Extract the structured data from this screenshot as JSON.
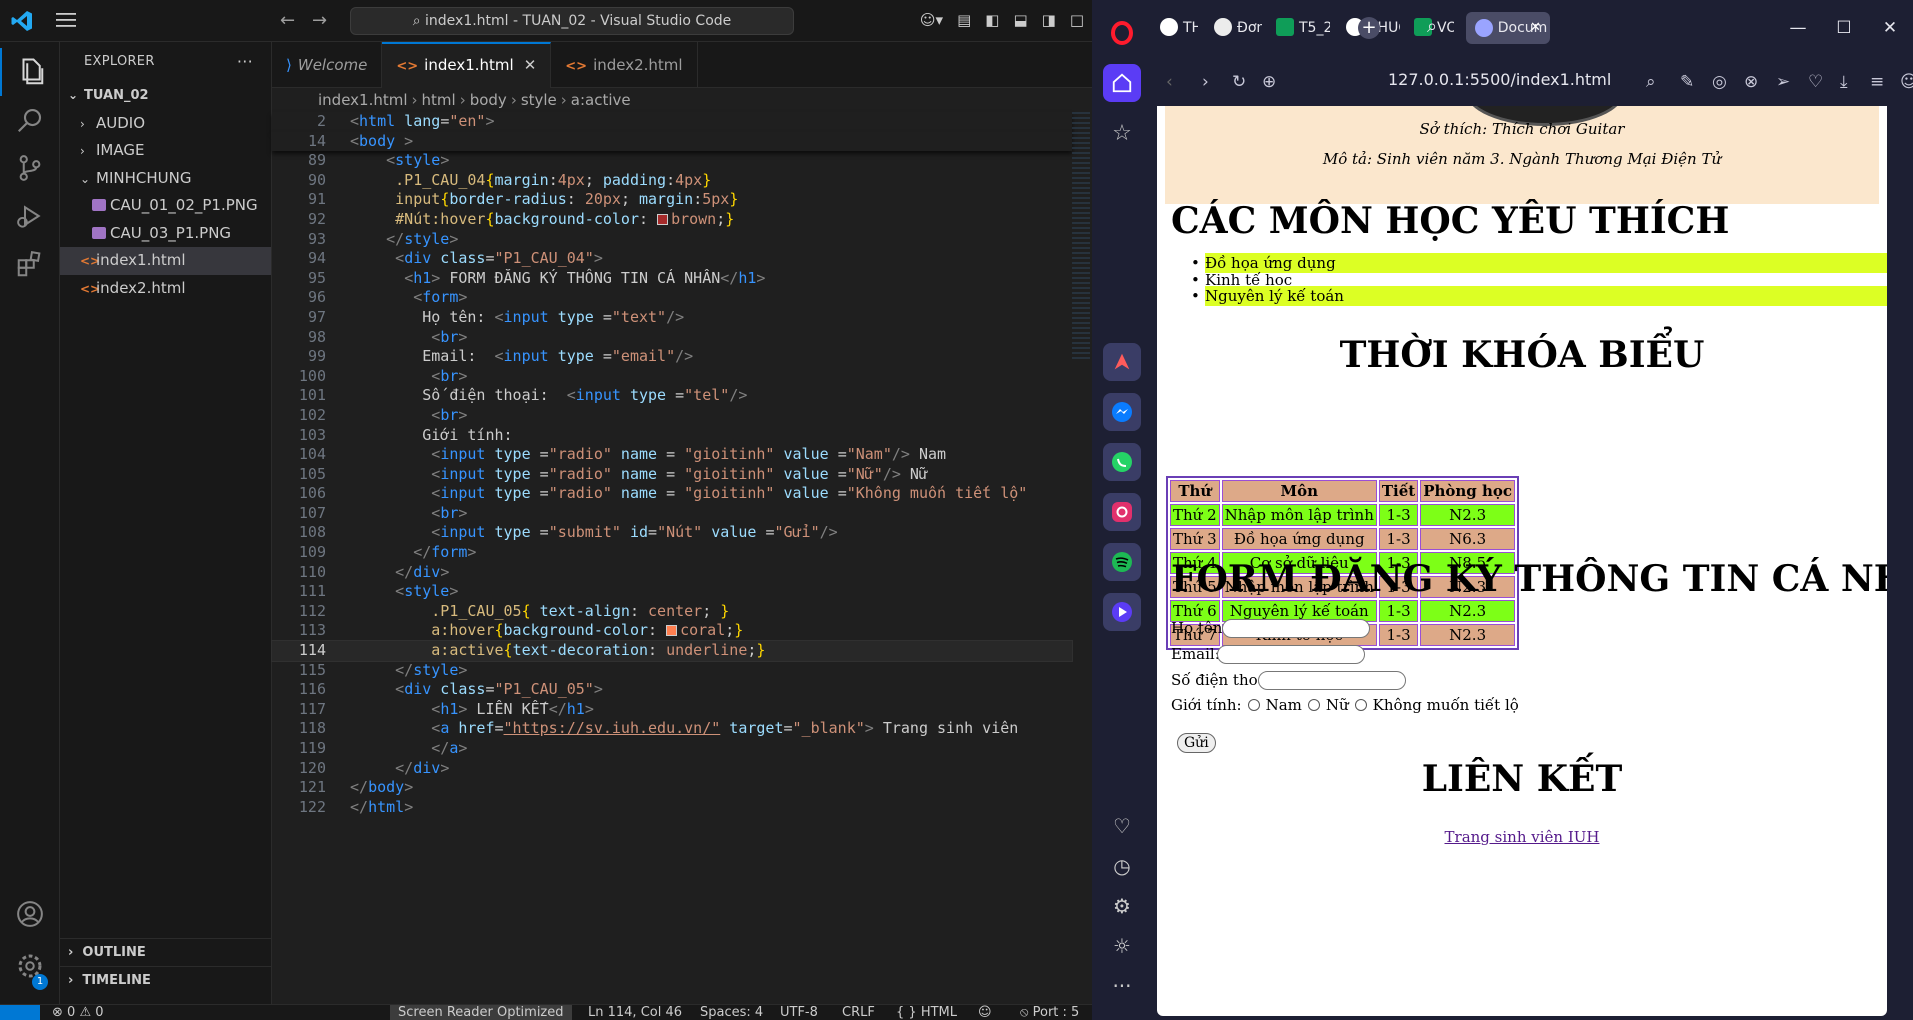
{
  "vscode": {
    "title": "index1.html - TUAN_02 - Visual Studio Code",
    "explorer_title": "EXPLORER",
    "folder": "TUAN_02",
    "tree": [
      {
        "label": "AUDIO",
        "kind": "folder",
        "open": false,
        "depth": 1
      },
      {
        "label": "IMAGE",
        "kind": "folder",
        "open": false,
        "depth": 1
      },
      {
        "label": "MINHCHUNG",
        "kind": "folder",
        "open": true,
        "depth": 1
      },
      {
        "label": "CAU_01_02_P1.PNG",
        "kind": "image",
        "depth": 2
      },
      {
        "label": "CAU_03_P1.PNG",
        "kind": "image",
        "depth": 2
      },
      {
        "label": "index1.html",
        "kind": "html",
        "depth": 1,
        "selected": true
      },
      {
        "label": "index2.html",
        "kind": "html",
        "depth": 1
      }
    ],
    "outline": "OUTLINE",
    "timeline": "TIMELINE",
    "tabs": [
      {
        "label": "Welcome",
        "icon": "vscode-icon",
        "active": false
      },
      {
        "label": "index1.html",
        "icon": "html-icon",
        "active": true
      },
      {
        "label": "index2.html",
        "icon": "html-icon",
        "active": false
      }
    ],
    "breadcrumb": [
      "index1.html",
      "html",
      "body",
      "style",
      "a:active"
    ],
    "current_line": 114,
    "status": {
      "errors": "0",
      "warnings": "0",
      "screen_reader": "Screen Reader Optimized",
      "position": "Ln 114, Col 46",
      "spaces": "Spaces: 4",
      "encoding": "UTF-8",
      "eol": "CRLF",
      "language": "HTML",
      "port": "Port : 5"
    },
    "settings_badge": "1"
  },
  "code_lines": [
    {
      "n": "2",
      "segs": [
        [
          "tb",
          "<"
        ],
        [
          "tg",
          "html"
        ],
        [
          "at",
          " lang"
        ],
        [
          "pn",
          "="
        ],
        [
          "st",
          "\"en\""
        ],
        [
          "tb",
          ">"
        ]
      ]
    },
    {
      "n": "14",
      "segs": [
        [
          "tb",
          "<"
        ],
        [
          "tg",
          "body"
        ],
        [
          "tb",
          " >"
        ]
      ]
    },
    {
      "n": "89",
      "segs": [
        [
          "pn",
          "    "
        ],
        [
          "tb",
          "<"
        ],
        [
          "tg",
          "style"
        ],
        [
          "tb",
          ">"
        ]
      ]
    },
    {
      "n": "90",
      "segs": [
        [
          "pn",
          "     "
        ],
        [
          "sel-c",
          ".P1_CAU_04"
        ],
        [
          "yb",
          "{"
        ],
        [
          "pr",
          "margin"
        ],
        [
          "pn",
          ":"
        ],
        [
          "vl",
          "4px"
        ],
        [
          "pn",
          "; "
        ],
        [
          "pr",
          "padding"
        ],
        [
          "pn",
          ":"
        ],
        [
          "vl",
          "4px"
        ],
        [
          "yb",
          "}"
        ]
      ]
    },
    {
      "n": "91",
      "segs": [
        [
          "pn",
          "     "
        ],
        [
          "sel-c",
          "input"
        ],
        [
          "yb",
          "{"
        ],
        [
          "pr",
          "border-radius"
        ],
        [
          "pn",
          ": "
        ],
        [
          "vl",
          "20px"
        ],
        [
          "pn",
          "; "
        ],
        [
          "pr",
          "margin"
        ],
        [
          "pn",
          ":"
        ],
        [
          "vl",
          "5px"
        ],
        [
          "yb",
          "}"
        ]
      ]
    },
    {
      "n": "92",
      "segs": [
        [
          "pn",
          "     "
        ],
        [
          "sel-c",
          "#Nút:hover"
        ],
        [
          "yb",
          "{"
        ],
        [
          "pr",
          "background-color"
        ],
        [
          "pn",
          ": "
        ],
        [
          "sw",
          "#a52a2a"
        ],
        [
          "vl",
          "brown"
        ],
        [
          "pn",
          ";"
        ],
        [
          "yb",
          "}"
        ]
      ]
    },
    {
      "n": "93",
      "segs": [
        [
          "pn",
          "    "
        ],
        [
          "tb",
          "</"
        ],
        [
          "tg",
          "style"
        ],
        [
          "tb",
          ">"
        ]
      ]
    },
    {
      "n": "94",
      "segs": [
        [
          "pn",
          "     "
        ],
        [
          "tb",
          "<"
        ],
        [
          "tg",
          "div"
        ],
        [
          "at",
          " class"
        ],
        [
          "pn",
          "="
        ],
        [
          "st",
          "\"P1_CAU_04\""
        ],
        [
          "tb",
          ">"
        ]
      ]
    },
    {
      "n": "95",
      "segs": [
        [
          "pn",
          "      "
        ],
        [
          "tb",
          "<"
        ],
        [
          "tg",
          "h1"
        ],
        [
          "tb",
          ">"
        ],
        [
          "pn",
          " FORM ĐĂNG KÝ THÔNG TIN CÁ NHÂN"
        ],
        [
          "tb",
          "</"
        ],
        [
          "tg",
          "h1"
        ],
        [
          "tb",
          ">"
        ]
      ]
    },
    {
      "n": "96",
      "segs": [
        [
          "pn",
          "       "
        ],
        [
          "tb",
          "<"
        ],
        [
          "tg",
          "form"
        ],
        [
          "tb",
          ">"
        ]
      ]
    },
    {
      "n": "97",
      "segs": [
        [
          "pn",
          "        Họ tên: "
        ],
        [
          "tb",
          "<"
        ],
        [
          "tg",
          "input"
        ],
        [
          "at",
          " type "
        ],
        [
          "pn",
          "="
        ],
        [
          "st",
          "\"text\""
        ],
        [
          "tb",
          "/>"
        ]
      ]
    },
    {
      "n": "98",
      "segs": [
        [
          "pn",
          "         "
        ],
        [
          "tb",
          "<"
        ],
        [
          "tg",
          "br"
        ],
        [
          "tb",
          ">"
        ]
      ]
    },
    {
      "n": "99",
      "segs": [
        [
          "pn",
          "        Email:  "
        ],
        [
          "tb",
          "<"
        ],
        [
          "tg",
          "input"
        ],
        [
          "at",
          " type "
        ],
        [
          "pn",
          "="
        ],
        [
          "st",
          "\"email\""
        ],
        [
          "tb",
          "/>"
        ]
      ]
    },
    {
      "n": "100",
      "segs": [
        [
          "pn",
          "         "
        ],
        [
          "tb",
          "<"
        ],
        [
          "tg",
          "br"
        ],
        [
          "tb",
          ">"
        ]
      ]
    },
    {
      "n": "101",
      "segs": [
        [
          "pn",
          "        Số điện thoại:  "
        ],
        [
          "tb",
          "<"
        ],
        [
          "tg",
          "input"
        ],
        [
          "at",
          " type "
        ],
        [
          "pn",
          "="
        ],
        [
          "st",
          "\"tel\""
        ],
        [
          "tb",
          "/>"
        ]
      ]
    },
    {
      "n": "102",
      "segs": [
        [
          "pn",
          "         "
        ],
        [
          "tb",
          "<"
        ],
        [
          "tg",
          "br"
        ],
        [
          "tb",
          ">"
        ]
      ]
    },
    {
      "n": "103",
      "segs": [
        [
          "pn",
          "        Giới tính:"
        ]
      ]
    },
    {
      "n": "104",
      "segs": [
        [
          "pn",
          "         "
        ],
        [
          "tb",
          "<"
        ],
        [
          "tg",
          "input"
        ],
        [
          "at",
          " type "
        ],
        [
          "pn",
          "="
        ],
        [
          "st",
          "\"radio\""
        ],
        [
          "at",
          " name "
        ],
        [
          "pn",
          "= "
        ],
        [
          "st",
          "\"gioitinh\""
        ],
        [
          "at",
          " value "
        ],
        [
          "pn",
          "="
        ],
        [
          "st",
          "\"Nam\""
        ],
        [
          "tb",
          "/>"
        ],
        [
          "pn",
          " Nam"
        ]
      ]
    },
    {
      "n": "105",
      "segs": [
        [
          "pn",
          "         "
        ],
        [
          "tb",
          "<"
        ],
        [
          "tg",
          "input"
        ],
        [
          "at",
          " type "
        ],
        [
          "pn",
          "="
        ],
        [
          "st",
          "\"radio\""
        ],
        [
          "at",
          " name "
        ],
        [
          "pn",
          "= "
        ],
        [
          "st",
          "\"gioitinh\""
        ],
        [
          "at",
          " value "
        ],
        [
          "pn",
          "="
        ],
        [
          "st",
          "\"Nữ\""
        ],
        [
          "tb",
          "/>"
        ],
        [
          "pn",
          " Nữ"
        ]
      ]
    },
    {
      "n": "106",
      "segs": [
        [
          "pn",
          "         "
        ],
        [
          "tb",
          "<"
        ],
        [
          "tg",
          "input"
        ],
        [
          "at",
          " type "
        ],
        [
          "pn",
          "="
        ],
        [
          "st",
          "\"radio\""
        ],
        [
          "at",
          " name "
        ],
        [
          "pn",
          "= "
        ],
        [
          "st",
          "\"gioitinh\""
        ],
        [
          "at",
          " value "
        ],
        [
          "pn",
          "="
        ],
        [
          "st",
          "\"Không muốn tiết lộ\""
        ]
      ]
    },
    {
      "n": "107",
      "segs": [
        [
          "pn",
          "         "
        ],
        [
          "tb",
          "<"
        ],
        [
          "tg",
          "br"
        ],
        [
          "tb",
          ">"
        ]
      ]
    },
    {
      "n": "108",
      "segs": [
        [
          "pn",
          "         "
        ],
        [
          "tb",
          "<"
        ],
        [
          "tg",
          "input"
        ],
        [
          "at",
          " type "
        ],
        [
          "pn",
          "="
        ],
        [
          "st",
          "\"submit\""
        ],
        [
          "at",
          " id"
        ],
        [
          "pn",
          "="
        ],
        [
          "st",
          "\"Nút\""
        ],
        [
          "at",
          " value "
        ],
        [
          "pn",
          "="
        ],
        [
          "st",
          "\"Gửi\""
        ],
        [
          "tb",
          "/>"
        ]
      ]
    },
    {
      "n": "109",
      "segs": [
        [
          "pn",
          "       "
        ],
        [
          "tb",
          "</"
        ],
        [
          "tg",
          "form"
        ],
        [
          "tb",
          ">"
        ]
      ]
    },
    {
      "n": "110",
      "segs": [
        [
          "pn",
          "     "
        ],
        [
          "tb",
          "</"
        ],
        [
          "tg",
          "div"
        ],
        [
          "tb",
          ">"
        ]
      ]
    },
    {
      "n": "111",
      "segs": [
        [
          "pn",
          "     "
        ],
        [
          "tb",
          "<"
        ],
        [
          "tg",
          "style"
        ],
        [
          "tb",
          ">"
        ]
      ]
    },
    {
      "n": "112",
      "segs": [
        [
          "pn",
          "         "
        ],
        [
          "sel-c",
          ".P1_CAU_05"
        ],
        [
          "yb",
          "{"
        ],
        [
          "pr",
          " text-align"
        ],
        [
          "pn",
          ": "
        ],
        [
          "vl",
          "center"
        ],
        [
          "pn",
          "; "
        ],
        [
          "yb",
          "}"
        ]
      ]
    },
    {
      "n": "113",
      "segs": [
        [
          "pn",
          "         "
        ],
        [
          "sel-c",
          "a:hover"
        ],
        [
          "yb",
          "{"
        ],
        [
          "pr",
          "background-color"
        ],
        [
          "pn",
          ": "
        ],
        [
          "sw",
          "#ff7f50"
        ],
        [
          "vl",
          "coral"
        ],
        [
          "pn",
          ";"
        ],
        [
          "yb",
          "}"
        ]
      ]
    },
    {
      "n": "114",
      "segs": [
        [
          "pn",
          "         "
        ],
        [
          "sel-c",
          "a:active"
        ],
        [
          "yb",
          "{"
        ],
        [
          "pr",
          "text-decoration"
        ],
        [
          "pn",
          ": "
        ],
        [
          "vl",
          "underline"
        ],
        [
          "pn",
          ";"
        ],
        [
          "yb",
          "}"
        ]
      ]
    },
    {
      "n": "115",
      "segs": [
        [
          "pn",
          "     "
        ],
        [
          "tb",
          "</"
        ],
        [
          "tg",
          "style"
        ],
        [
          "tb",
          ">"
        ]
      ]
    },
    {
      "n": "116",
      "segs": [
        [
          "pn",
          "     "
        ],
        [
          "tb",
          "<"
        ],
        [
          "tg",
          "div"
        ],
        [
          "at",
          " class"
        ],
        [
          "pn",
          "="
        ],
        [
          "st",
          "\"P1_CAU_05\""
        ],
        [
          "tb",
          ">"
        ]
      ]
    },
    {
      "n": "117",
      "segs": [
        [
          "pn",
          "         "
        ],
        [
          "tb",
          "<"
        ],
        [
          "tg",
          "h1"
        ],
        [
          "tb",
          ">"
        ],
        [
          "pn",
          " LIÊN KẾT"
        ],
        [
          "tb",
          "</"
        ],
        [
          "tg",
          "h1"
        ],
        [
          "tb",
          ">"
        ]
      ]
    },
    {
      "n": "118",
      "segs": [
        [
          "pn",
          "         "
        ],
        [
          "tb",
          "<"
        ],
        [
          "tg",
          "a"
        ],
        [
          "at",
          " href"
        ],
        [
          "pn",
          "="
        ],
        [
          "lnk",
          "\"https://sv.iuh.edu.vn/\""
        ],
        [
          "at",
          " target"
        ],
        [
          "pn",
          "="
        ],
        [
          "st",
          "\"_blank\""
        ],
        [
          "tb",
          ">"
        ],
        [
          "pn",
          " Trang sinh viên"
        ]
      ]
    },
    {
      "n": "119",
      "segs": [
        [
          "pn",
          "         "
        ],
        [
          "tb",
          "</"
        ],
        [
          "tg",
          "a"
        ],
        [
          "tb",
          ">"
        ]
      ]
    },
    {
      "n": "120",
      "segs": [
        [
          "pn",
          "     "
        ],
        [
          "tb",
          "</"
        ],
        [
          "tg",
          "div"
        ],
        [
          "tb",
          ">"
        ]
      ]
    },
    {
      "n": "121",
      "segs": [
        [
          "tb",
          "</"
        ],
        [
          "tg",
          "body"
        ],
        [
          "tb",
          ">"
        ]
      ]
    },
    {
      "n": "122",
      "segs": [
        [
          "tb",
          "</"
        ],
        [
          "tg",
          "html"
        ],
        [
          "tb",
          ">"
        ]
      ]
    }
  ],
  "browser": {
    "tabs": [
      {
        "label": "THUC",
        "icon": "github-icon"
      },
      {
        "label": "Đơn v",
        "icon": "chatgpt-icon"
      },
      {
        "label": "T5_2",
        "icon": "sheets-icon"
      },
      {
        "label": "THUC",
        "icon": "github-icon"
      },
      {
        "label": "VOC/",
        "icon": "sheets-icon"
      },
      {
        "label": "Docum",
        "icon": "globe-icon",
        "active": true
      }
    ],
    "url": "127.0.0.1:5500/index1.html",
    "page": {
      "hobby": "Sở thích: Thích chơi Guitar",
      "description": "Mô tả: Sinh viên năm 3. Ngành Thương Mại Điện Tử",
      "fav_title": "CÁC MÔN HỌC YÊU THÍCH",
      "favorites": [
        "Đồ họa ứng dụng",
        "Kinh tế học",
        "Nguyên lý kế toán"
      ],
      "tkb_title": "THỜI KHÓA BIỂU",
      "tkb_headers": [
        "Thứ",
        "Môn",
        "Tiết",
        "Phòng học"
      ],
      "tkb_rows": [
        [
          "Thứ 2",
          "Nhập môn lập trình",
          "1-3",
          "N2.3"
        ],
        [
          "Thứ 3",
          "Đồ họa ứng dụng",
          "1-3",
          "N6.3"
        ],
        [
          "Thứ 4",
          "Cơ sở dữ liệu",
          "1-3",
          "N8.5"
        ],
        [
          "Thứ 5",
          "Nhập môn lập trình",
          "1-3",
          "N2.3"
        ],
        [
          "Thứ 6",
          "Nguyên lý kế toán",
          "1-3",
          "N2.3"
        ],
        [
          "Thứ 7",
          "Kinh tế học",
          "1-3",
          "N2.3"
        ]
      ],
      "form_title": "FORM ĐĂNG KÝ THÔNG TIN CÁ NHÂN",
      "label_name": "Họ tên:",
      "label_email": "Email:",
      "label_phone": "Số điện thoại:",
      "label_gender": "Giới tính:",
      "gender_options": [
        "Nam",
        "Nữ",
        "Không muốn tiết lộ"
      ],
      "submit": "Gửi",
      "link_title": "LIÊN KẾT",
      "link_text": "Trang sinh viên IUH"
    }
  }
}
